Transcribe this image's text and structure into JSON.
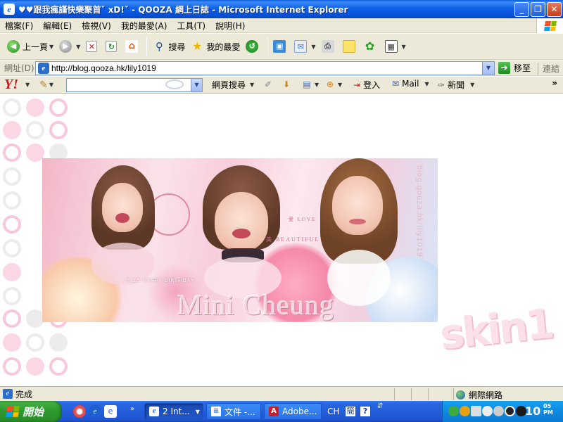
{
  "window": {
    "title": "♥♥跟我瘋謹快樂聚首ˇ xD!ˇ - QOOZA 網上日誌 - Microsoft Internet Explorer",
    "icon": "ie-icon",
    "controls": {
      "minimize": "_",
      "maximize": "❐",
      "close": "✕"
    }
  },
  "menu": {
    "items": [
      "檔案(F)",
      "編輯(E)",
      "檢視(V)",
      "我的最愛(A)",
      "工具(T)",
      "說明(H)"
    ]
  },
  "toolbar": {
    "back_label": "上一頁",
    "search_label": "搜尋",
    "favorites_label": "我的最愛"
  },
  "address": {
    "label": "網址(D)",
    "url": "http://blog.qooza.hk/lily1019",
    "go_label": "移至",
    "links_label": "連結"
  },
  "yahoo": {
    "logo": "Y!",
    "search_placeholder": "",
    "web_search_label": "網頁搜尋",
    "login_label": "登入",
    "mail_label": "Mail",
    "news_label": "新聞",
    "more": "»"
  },
  "banner": {
    "birthday_text": "7.25 HAPPY BIRTHDAY",
    "name": "Mini Cheung",
    "beautiful_text": "美 BEAUTIFUL",
    "love_text": "愛 LOVE",
    "vertical_url": "blog.qooza.hk/lily1019"
  },
  "skin_label": "skin1",
  "status": {
    "text": "完成",
    "zone": "網際網路"
  },
  "taskbar": {
    "start_label": "開始",
    "tasks": [
      {
        "label": "2 Int...",
        "icon": "ie-icon",
        "active": true
      },
      {
        "label": "文件 -...",
        "icon": "document-icon",
        "active": false
      },
      {
        "label": "Adobe...",
        "icon": "adobe-icon",
        "active": false
      }
    ],
    "lang": "CH",
    "clock": "10",
    "clock_minutes": "05",
    "clock_ampm": "PM"
  },
  "colors": {
    "titlebar": "#0a5ddb",
    "chrome": "#ece9d8",
    "start": "#2f9a2f",
    "pink_dot": "#fbd6e5"
  }
}
